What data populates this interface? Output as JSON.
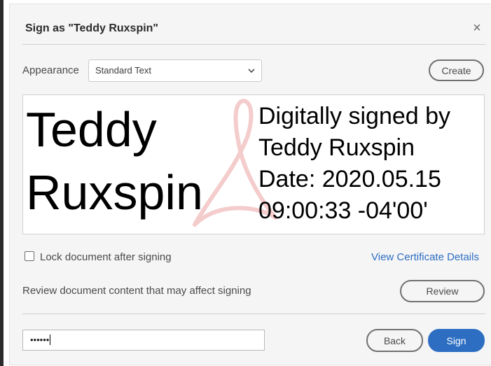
{
  "dialog": {
    "title": "Sign as \"Teddy Ruxspin\"",
    "close_glyph": "×",
    "close_icon": "close-icon"
  },
  "appearance": {
    "label": "Appearance",
    "selected": "Standard Text",
    "create_label": "Create"
  },
  "signature_preview": {
    "name_line1": "Teddy",
    "name_line2": "Ruxspin",
    "info_lines": [
      "Digitally signed by",
      "Teddy Ruxspin",
      "Date: 2020.05.15",
      "09:00:33 -04'00'"
    ],
    "watermark_icon": "acrobat-logo-watermark",
    "watermark_color": "#f3c9c9"
  },
  "options": {
    "lock_label": "Lock document after signing",
    "lock_checked": false,
    "certificate_link": "View Certificate Details"
  },
  "review": {
    "text": "Review document content that may affect signing",
    "button_label": "Review"
  },
  "password": {
    "masked_value": "••••••"
  },
  "footer": {
    "back_label": "Back",
    "sign_label": "Sign"
  },
  "colors": {
    "accent": "#2d6ec3",
    "dialog_bg": "#f5f5f5"
  }
}
